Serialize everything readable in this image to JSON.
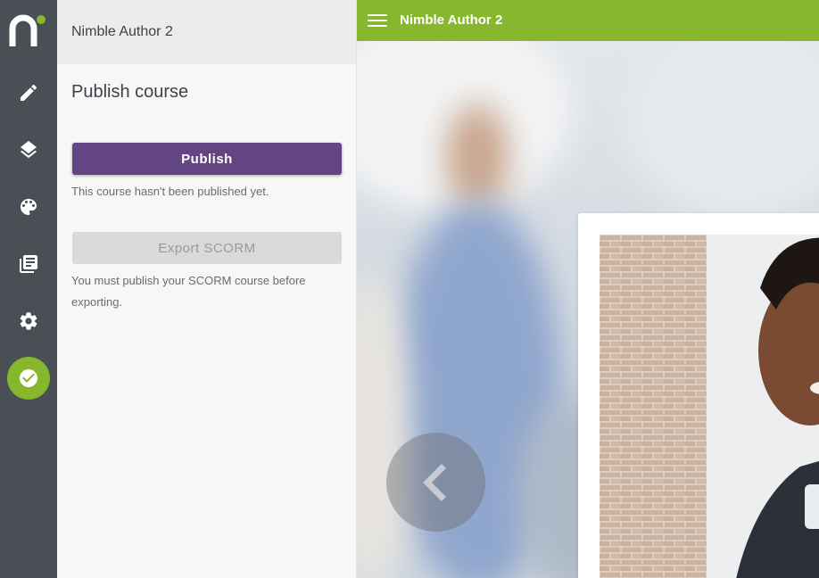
{
  "app": {
    "title": "Nimble Author 2"
  },
  "rail": {
    "items": [
      {
        "icon": "pencil-icon",
        "label": "Edit"
      },
      {
        "icon": "layers-icon",
        "label": "Structure"
      },
      {
        "icon": "palette-icon",
        "label": "Theme"
      },
      {
        "icon": "library-icon",
        "label": "Library"
      },
      {
        "icon": "gear-icon",
        "label": "Settings"
      },
      {
        "icon": "check-circle-icon",
        "label": "Publish",
        "active": true
      }
    ]
  },
  "panel": {
    "header": "Nimble Author 2",
    "title": "Publish course",
    "publish_button": "Publish",
    "publish_status": "This course hasn't been published yet.",
    "export_button": "Export SCORM",
    "export_note": "You must publish your SCORM course before exporting."
  },
  "preview": {
    "topbar_title": "Nimble Author 2"
  },
  "colors": {
    "rail_bg": "#4a4f55",
    "accent_green": "#86b72d",
    "publish_purple": "#634584",
    "disabled_gray": "#dadada"
  }
}
